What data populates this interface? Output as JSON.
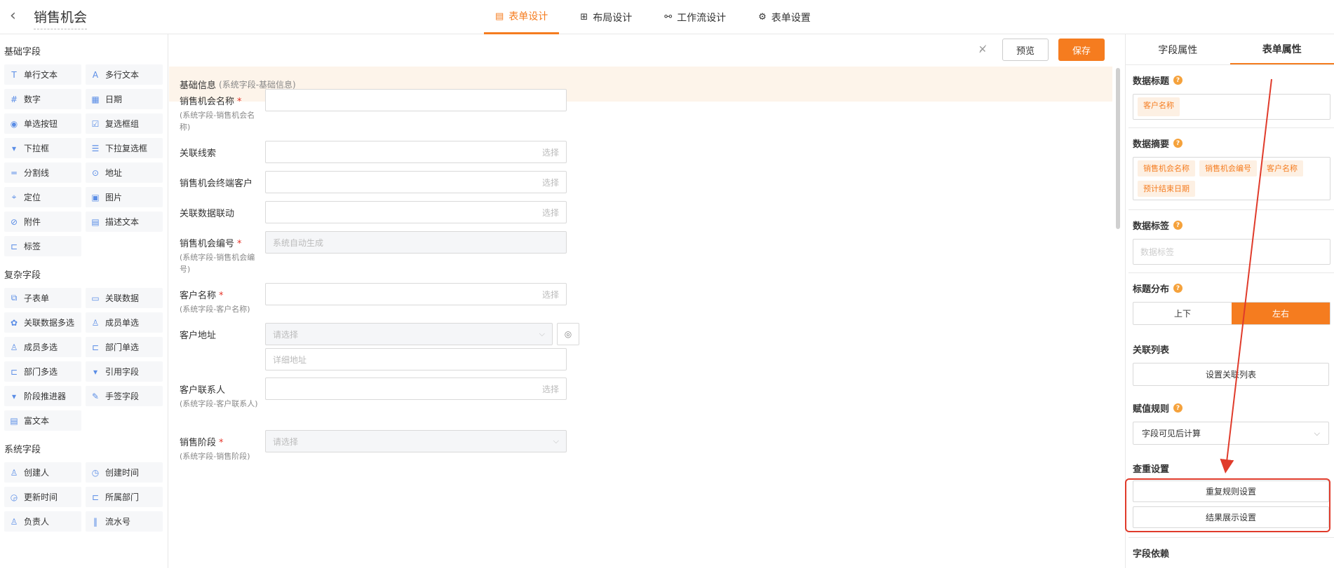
{
  "header": {
    "back_icon": "chevron-left-icon",
    "title": "销售机会",
    "tabs": [
      {
        "label": "表单设计",
        "icon": "form-icon",
        "glyph": "▤",
        "active": true
      },
      {
        "label": "布局设计",
        "icon": "layout-icon",
        "glyph": "⊞",
        "active": false
      },
      {
        "label": "工作流设计",
        "icon": "workflow-icon",
        "glyph": "⚯",
        "active": false
      },
      {
        "label": "表单设置",
        "icon": "gear-icon",
        "glyph": "⚙",
        "active": false
      }
    ]
  },
  "palette": {
    "groups": [
      {
        "title": "基础字段",
        "items": [
          {
            "label": "单行文本",
            "glyph": "T"
          },
          {
            "label": "多行文本",
            "glyph": "A"
          },
          {
            "label": "数字",
            "glyph": "#"
          },
          {
            "label": "日期",
            "glyph": "▦"
          },
          {
            "label": "单选按钮",
            "glyph": "◉"
          },
          {
            "label": "复选框组",
            "glyph": "☑"
          },
          {
            "label": "下拉框",
            "glyph": "▾"
          },
          {
            "label": "下拉复选框",
            "glyph": "☰"
          },
          {
            "label": "分割线",
            "glyph": "═"
          },
          {
            "label": "地址",
            "glyph": "⊙"
          },
          {
            "label": "定位",
            "glyph": "⌖"
          },
          {
            "label": "图片",
            "glyph": "▣"
          },
          {
            "label": "附件",
            "glyph": "⊘"
          },
          {
            "label": "描述文本",
            "glyph": "▤"
          },
          {
            "label": "标签",
            "glyph": "⊏"
          }
        ]
      },
      {
        "title": "复杂字段",
        "items": [
          {
            "label": "子表单",
            "glyph": "⧉"
          },
          {
            "label": "关联数据",
            "glyph": "▭"
          },
          {
            "label": "关联数据多选",
            "glyph": "✿"
          },
          {
            "label": "成员单选",
            "glyph": "♙"
          },
          {
            "label": "成员多选",
            "glyph": "♙"
          },
          {
            "label": "部门单选",
            "glyph": "⊏"
          },
          {
            "label": "部门多选",
            "glyph": "⊏"
          },
          {
            "label": "引用字段",
            "glyph": "▾"
          },
          {
            "label": "阶段推进器",
            "glyph": "▾"
          },
          {
            "label": "手签字段",
            "glyph": "✎"
          },
          {
            "label": "富文本",
            "glyph": "▤"
          }
        ]
      },
      {
        "title": "系统字段",
        "items": [
          {
            "label": "创建人",
            "glyph": "♙"
          },
          {
            "label": "创建时间",
            "glyph": "◷"
          },
          {
            "label": "更新时间",
            "glyph": "◶"
          },
          {
            "label": "所属部门",
            "glyph": "⊏"
          },
          {
            "label": "负责人",
            "glyph": "♙"
          },
          {
            "label": "流水号",
            "glyph": "‖"
          }
        ]
      }
    ]
  },
  "canvas": {
    "toolbar": {
      "preview_label": "预览",
      "save_label": "保存",
      "magic_icon": "magic-wand-icon"
    },
    "section": {
      "title": "基础信息",
      "subtitle": "(系统字段-基础信息)"
    },
    "fields": [
      {
        "label": "销售机会名称",
        "required": true,
        "sub": "(系统字段-销售机会名称)",
        "value": "",
        "placeholder": "",
        "kind": "text"
      },
      {
        "label": "关联线索",
        "required": false,
        "sub": "",
        "value": "",
        "placeholder": "选择",
        "kind": "pick"
      },
      {
        "label": "销售机会终端客户",
        "required": false,
        "sub": "",
        "value": "",
        "placeholder": "选择",
        "kind": "pick"
      },
      {
        "label": "关联数据联动",
        "required": false,
        "sub": "",
        "value": "",
        "placeholder": "选择",
        "kind": "pick"
      },
      {
        "label": "销售机会编号",
        "required": true,
        "sub": "(系统字段-销售机会编号)",
        "value": "",
        "placeholder": "系统自动生成",
        "kind": "disabled"
      },
      {
        "label": "客户名称",
        "required": true,
        "sub": "(系统字段-客户名称)",
        "value": "",
        "placeholder": "选择",
        "kind": "pick"
      },
      {
        "label": "客户地址",
        "required": false,
        "sub": "",
        "value": "",
        "placeholder": "请选择",
        "placeholder2": "详细地址",
        "kind": "address"
      },
      {
        "label": "客户联系人",
        "required": false,
        "sub": "(系统字段-客户联系人)",
        "value": "",
        "placeholder": "选择",
        "kind": "pick"
      },
      {
        "label": "销售阶段",
        "required": true,
        "sub": "(系统字段-销售阶段)",
        "value": "",
        "placeholder": "请选择",
        "kind": "select-disabled"
      }
    ]
  },
  "panel": {
    "tabs": [
      {
        "label": "字段属性",
        "active": false
      },
      {
        "label": "表单属性",
        "active": true
      }
    ],
    "data_title": {
      "label": "数据标题",
      "tags": [
        "客户名称"
      ]
    },
    "data_summary": {
      "label": "数据摘要",
      "tags": [
        "销售机会名称",
        "销售机会编号",
        "客户名称",
        "预计结束日期"
      ]
    },
    "data_tags": {
      "label": "数据标签",
      "placeholder": "数据标签"
    },
    "title_layout": {
      "label": "标题分布",
      "options": [
        "上下",
        "左右"
      ],
      "selected": "左右"
    },
    "related_list": {
      "label": "关联列表",
      "button": "设置关联列表"
    },
    "assign_rule": {
      "label": "赋值规则",
      "value": "字段可见后计算"
    },
    "dedupe": {
      "label": "查重设置",
      "rule_button": "重复规则设置",
      "result_button": "结果展示设置"
    },
    "field_dependency": {
      "label": "字段依赖"
    }
  },
  "colors": {
    "accent": "#f57c1f",
    "annotation": "#e03b2b"
  }
}
